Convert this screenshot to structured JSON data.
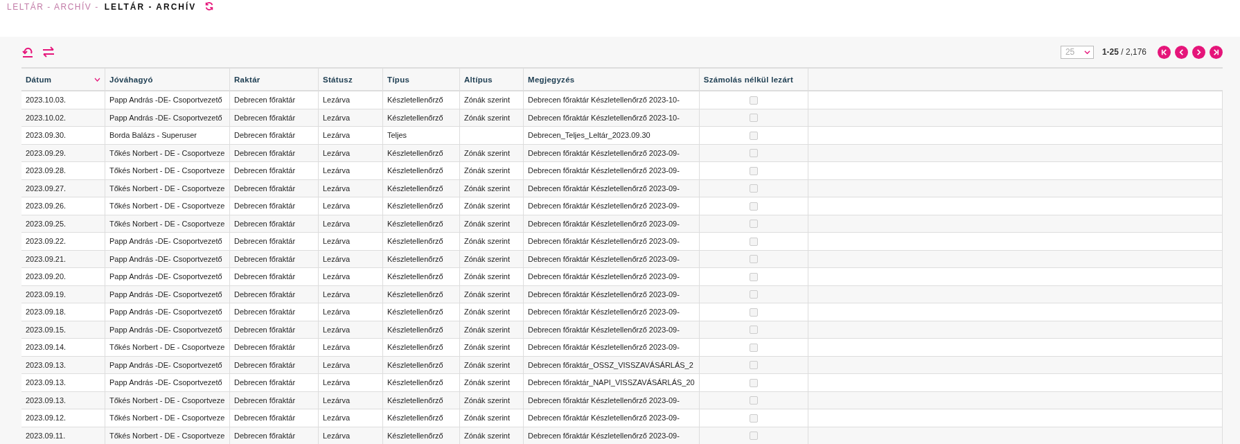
{
  "breadcrumb": [
    {
      "label": "LELTÁR - ARCHÍV -",
      "selected": false
    },
    {
      "label": "LELTÁR - ARCHÍV",
      "selected": true
    }
  ],
  "pager": {
    "page_size": "25",
    "range": "**1-25** / 2,176"
  },
  "table": {
    "columns": [
      {
        "label": "Dátum",
        "sorted": true
      },
      {
        "label": "Jóváhagyó",
        "sorted": false
      },
      {
        "label": "Raktár",
        "sorted": false
      },
      {
        "label": "Státusz",
        "sorted": false
      },
      {
        "label": "Típus",
        "sorted": false
      },
      {
        "label": "Altípus",
        "sorted": false
      },
      {
        "label": "Megjegyzés",
        "sorted": false
      },
      {
        "label": "Számolás nélkül lezárt",
        "sorted": false
      }
    ],
    "rows": [
      {
        "cells": [
          "2023.10.03.",
          "Papp András -DE- Csoportvezető",
          "Debrecen főraktár",
          "Lezárva",
          "Készletellenőrző",
          "Zónák szerint",
          "Debrecen főraktár Készletellenőrző 2023-10-"
        ],
        "checked": false
      },
      {
        "cells": [
          "2023.10.02.",
          "Papp András -DE- Csoportvezető",
          "Debrecen főraktár",
          "Lezárva",
          "Készletellenőrző",
          "Zónák szerint",
          "Debrecen főraktár Készletellenőrző 2023-10-"
        ],
        "checked": false
      },
      {
        "cells": [
          "2023.09.30.",
          "Borda Balázs - Superuser",
          "Debrecen főraktár",
          "Lezárva",
          "Teljes",
          "",
          "Debrecen_Teljes_Leltár_2023.09.30"
        ],
        "checked": false
      },
      {
        "cells": [
          "2023.09.29.",
          "Tőkés Norbert - DE - Csoportveze",
          "Debrecen főraktár",
          "Lezárva",
          "Készletellenőrző",
          "Zónák szerint",
          "Debrecen főraktár Készletellenőrző 2023-09-"
        ],
        "checked": false
      },
      {
        "cells": [
          "2023.09.28.",
          "Tőkés Norbert - DE - Csoportveze",
          "Debrecen főraktár",
          "Lezárva",
          "Készletellenőrző",
          "Zónák szerint",
          "Debrecen főraktár Készletellenőrző 2023-09-"
        ],
        "checked": false
      },
      {
        "cells": [
          "2023.09.27.",
          "Tőkés Norbert - DE - Csoportveze",
          "Debrecen főraktár",
          "Lezárva",
          "Készletellenőrző",
          "Zónák szerint",
          "Debrecen főraktár Készletellenőrző 2023-09-"
        ],
        "checked": false
      },
      {
        "cells": [
          "2023.09.26.",
          "Tőkés Norbert - DE - Csoportveze",
          "Debrecen főraktár",
          "Lezárva",
          "Készletellenőrző",
          "Zónák szerint",
          "Debrecen főraktár Készletellenőrző 2023-09-"
        ],
        "checked": false
      },
      {
        "cells": [
          "2023.09.25.",
          "Tőkés Norbert - DE - Csoportveze",
          "Debrecen főraktár",
          "Lezárva",
          "Készletellenőrző",
          "Zónák szerint",
          "Debrecen főraktár Készletellenőrző 2023-09-"
        ],
        "checked": false
      },
      {
        "cells": [
          "2023.09.22.",
          "Papp András -DE- Csoportvezető",
          "Debrecen főraktár",
          "Lezárva",
          "Készletellenőrző",
          "Zónák szerint",
          "Debrecen főraktár Készletellenőrző 2023-09-"
        ],
        "checked": false
      },
      {
        "cells": [
          "2023.09.21.",
          "Papp András -DE- Csoportvezető",
          "Debrecen főraktár",
          "Lezárva",
          "Készletellenőrző",
          "Zónák szerint",
          "Debrecen főraktár Készletellenőrző 2023-09-"
        ],
        "checked": false
      },
      {
        "cells": [
          "2023.09.20.",
          "Papp András -DE- Csoportvezető",
          "Debrecen főraktár",
          "Lezárva",
          "Készletellenőrző",
          "Zónák szerint",
          "Debrecen főraktár Készletellenőrző 2023-09-"
        ],
        "checked": false
      },
      {
        "cells": [
          "2023.09.19.",
          "Papp András -DE- Csoportvezető",
          "Debrecen főraktár",
          "Lezárva",
          "Készletellenőrző",
          "Zónák szerint",
          "Debrecen főraktár Készletellenőrző 2023-09-"
        ],
        "checked": false
      },
      {
        "cells": [
          "2023.09.18.",
          "Papp András -DE- Csoportvezető",
          "Debrecen főraktár",
          "Lezárva",
          "Készletellenőrző",
          "Zónák szerint",
          "Debrecen főraktár Készletellenőrző 2023-09-"
        ],
        "checked": false
      },
      {
        "cells": [
          "2023.09.15.",
          "Papp András -DE- Csoportvezető",
          "Debrecen főraktár",
          "Lezárva",
          "Készletellenőrző",
          "Zónák szerint",
          "Debrecen főraktár Készletellenőrző 2023-09-"
        ],
        "checked": false
      },
      {
        "cells": [
          "2023.09.14.",
          "Tőkés Norbert - DE - Csoportveze",
          "Debrecen főraktár",
          "Lezárva",
          "Készletellenőrző",
          "Zónák szerint",
          "Debrecen főraktár Készletellenőrző 2023-09-"
        ],
        "checked": false
      },
      {
        "cells": [
          "2023.09.13.",
          "Papp András -DE- Csoportvezető",
          "Debrecen főraktár",
          "Lezárva",
          "Készletellenőrző",
          "Zónák szerint",
          "Debrecen főraktár_OSSZ_VISSZAVÁSÁRLÁS_2"
        ],
        "checked": false
      },
      {
        "cells": [
          "2023.09.13.",
          "Papp András -DE- Csoportvezető",
          "Debrecen főraktár",
          "Lezárva",
          "Készletellenőrző",
          "Zónák szerint",
          "Debrecen főraktár_NAPI_VISSZAVÁSÁRLÁS_20"
        ],
        "checked": false
      },
      {
        "cells": [
          "2023.09.13.",
          "Tőkés Norbert - DE - Csoportveze",
          "Debrecen főraktár",
          "Lezárva",
          "Készletellenőrző",
          "Zónák szerint",
          "Debrecen főraktár Készletellenőrző 2023-09-"
        ],
        "checked": false
      },
      {
        "cells": [
          "2023.09.12.",
          "Tőkés Norbert - DE - Csoportveze",
          "Debrecen főraktár",
          "Lezárva",
          "Készletellenőrző",
          "Zónák szerint",
          "Debrecen főraktár Készletellenőrző 2023-09-"
        ],
        "checked": false
      },
      {
        "cells": [
          "2023.09.11.",
          "Tőkés Norbert - DE - Csoportveze",
          "Debrecen főraktár",
          "Lezárva",
          "Készletellenőrző",
          "Zónák szerint",
          "Debrecen főraktár Készletellenőrző 2023-09-"
        ],
        "checked": false
      }
    ]
  }
}
